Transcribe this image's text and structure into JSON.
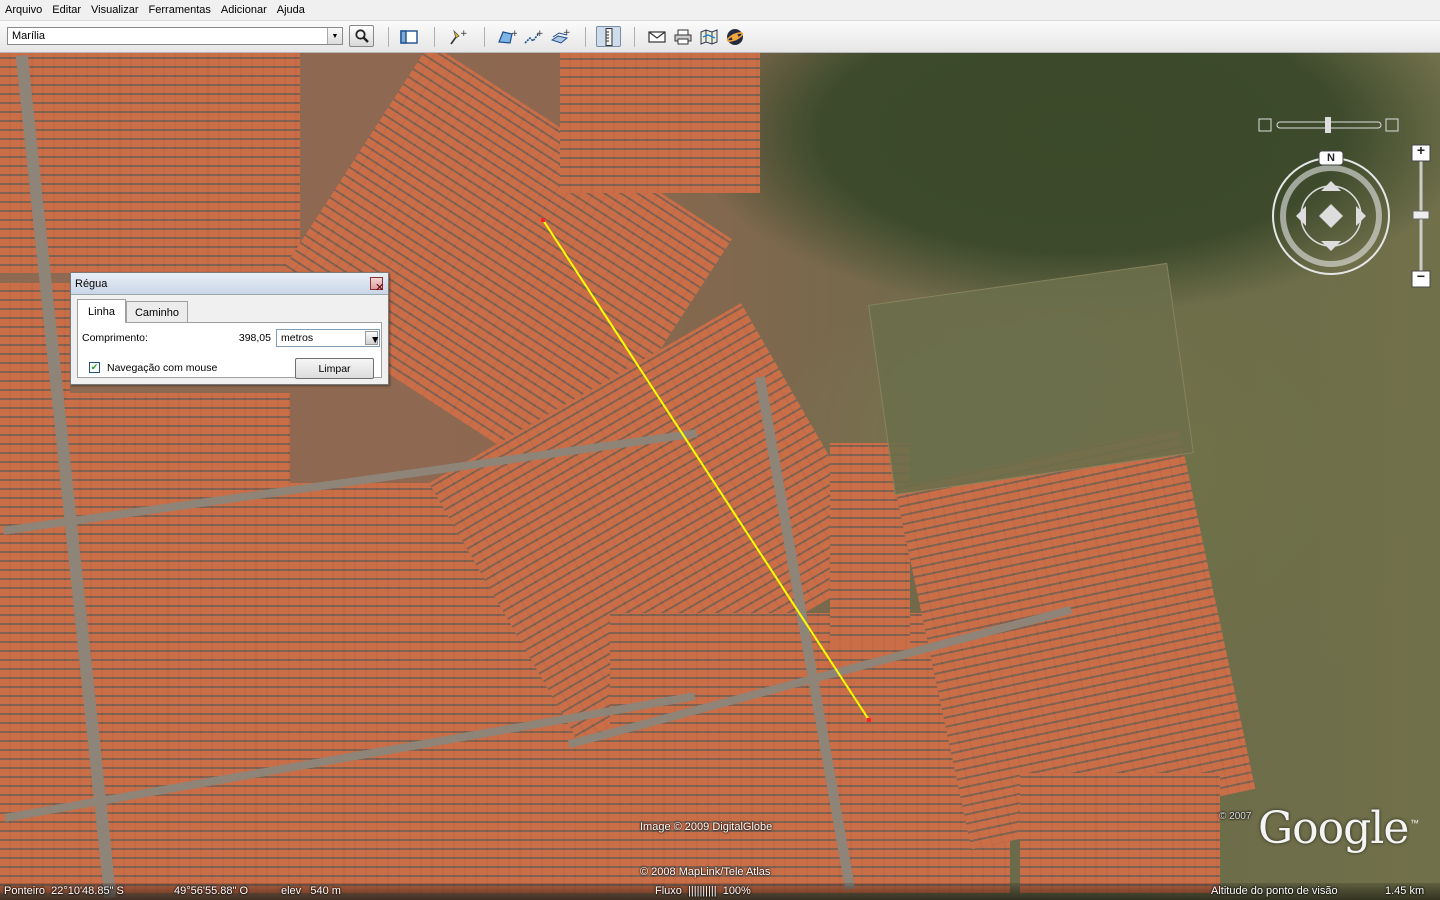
{
  "menu": [
    "Arquivo",
    "Editar",
    "Visualizar",
    "Ferramentas",
    "Adicionar",
    "Ajuda"
  ],
  "search": {
    "value": "Marília"
  },
  "toolbar": {
    "icons": [
      "sidebar-toggle-icon",
      "placemark-icon",
      "polygon-icon",
      "path-icon",
      "image-overlay-icon",
      "ruler-icon",
      "email-icon",
      "print-icon",
      "google-maps-icon",
      "sky-icon"
    ]
  },
  "ruler": {
    "title": "Régua",
    "tabs": [
      "Linha",
      "Caminho"
    ],
    "length_label": "Comprimento:",
    "length_value": "398,05",
    "unit": "metros",
    "nav_label": "Navegação com mouse",
    "nav_checked": true,
    "clear_label": "Limpar"
  },
  "compass": {
    "north": "N"
  },
  "zoom": {
    "plus": "+",
    "minus": "−"
  },
  "attribution": {
    "imagery": "Image © 2009 DigitalGlobe",
    "maplink": "© 2008 MapLink/Tele Atlas",
    "copyright": "© 2007"
  },
  "logo": "Google",
  "status": {
    "pointer": "Ponteiro  22°10'48.85\" S",
    "longitude": "49°56'55.88\" O",
    "elevation": "elev   540 m",
    "stream": "Fluxo  ||||||||||  100%",
    "eye_alt_label": "Altitude do ponto de visão",
    "eye_alt_value": "1.45 km"
  },
  "colors": {
    "ruler_line": "#ffff00",
    "ruler_endpoint": "#ff2020"
  }
}
